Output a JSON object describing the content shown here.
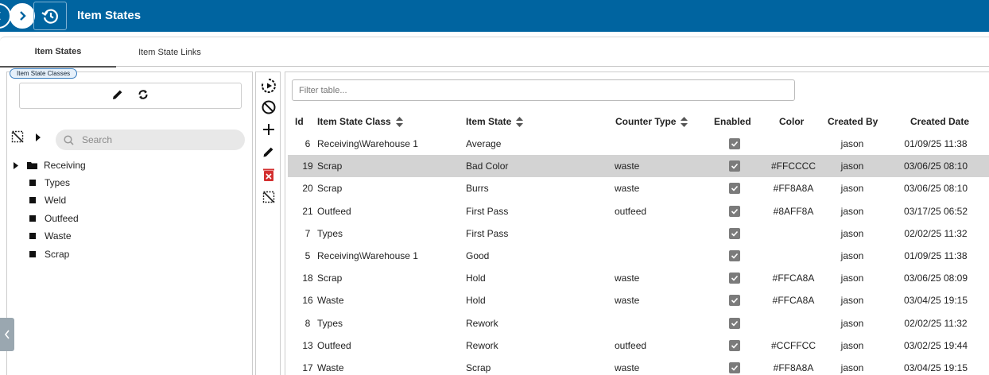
{
  "header": {
    "title": "Item States"
  },
  "tabs": [
    {
      "label": "Item States",
      "active": true
    },
    {
      "label": "Item State Links",
      "active": false
    }
  ],
  "left": {
    "badge": "Item State Classes",
    "search_placeholder": "Search",
    "tree": [
      {
        "label": "Receiving",
        "type": "folder"
      },
      {
        "label": "Types",
        "type": "leaf"
      },
      {
        "label": "Weld",
        "type": "leaf"
      },
      {
        "label": "Outfeed",
        "type": "leaf"
      },
      {
        "label": "Waste",
        "type": "leaf"
      },
      {
        "label": "Scrap",
        "type": "leaf"
      }
    ]
  },
  "toolbar": {
    "icons": [
      "play-circle-icon",
      "block-icon",
      "add-icon",
      "edit-icon",
      "delete-icon",
      "deselect-icon"
    ]
  },
  "table": {
    "filter_placeholder": "Filter table...",
    "columns": [
      "Id",
      "Item State Class",
      "Item State",
      "Counter Type",
      "Enabled",
      "Color",
      "Created By",
      "Created Date"
    ],
    "rows": [
      {
        "id": "6",
        "cls": "Receiving\\Warehouse 1",
        "state": "Average",
        "counter": "",
        "color": "",
        "by": "jason",
        "date": "01/09/25 11:38",
        "enabled": true
      },
      {
        "id": "19",
        "cls": "Scrap",
        "state": "Bad Color",
        "counter": "waste",
        "color": "#FFCCCC",
        "by": "jason",
        "date": "03/06/25 08:10",
        "enabled": true,
        "selected": true
      },
      {
        "id": "20",
        "cls": "Scrap",
        "state": "Burrs",
        "counter": "waste",
        "color": "#FF8A8A",
        "by": "jason",
        "date": "03/06/25 08:10",
        "enabled": true
      },
      {
        "id": "21",
        "cls": "Outfeed",
        "state": "First Pass",
        "counter": "outfeed",
        "color": "#8AFF8A",
        "by": "jason",
        "date": "03/17/25 06:52",
        "enabled": true
      },
      {
        "id": "7",
        "cls": "Types",
        "state": "First Pass",
        "counter": "",
        "color": "",
        "by": "jason",
        "date": "02/02/25 11:32",
        "enabled": true
      },
      {
        "id": "5",
        "cls": "Receiving\\Warehouse 1",
        "state": "Good",
        "counter": "",
        "color": "",
        "by": "jason",
        "date": "01/09/25 11:38",
        "enabled": true
      },
      {
        "id": "18",
        "cls": "Scrap",
        "state": "Hold",
        "counter": "waste",
        "color": "#FFCA8A",
        "by": "jason",
        "date": "03/06/25 08:09",
        "enabled": true
      },
      {
        "id": "16",
        "cls": "Waste",
        "state": "Hold",
        "counter": "waste",
        "color": "#FFCA8A",
        "by": "jason",
        "date": "03/04/25 19:15",
        "enabled": true
      },
      {
        "id": "8",
        "cls": "Types",
        "state": "Rework",
        "counter": "",
        "color": "",
        "by": "jason",
        "date": "02/02/25 11:32",
        "enabled": true
      },
      {
        "id": "13",
        "cls": "Outfeed",
        "state": "Rework",
        "counter": "outfeed",
        "color": "#CCFFCC",
        "by": "jason",
        "date": "03/02/25 19:44",
        "enabled": true
      },
      {
        "id": "17",
        "cls": "Waste",
        "state": "Scrap",
        "counter": "waste",
        "color": "#FF8A8A",
        "by": "jason",
        "date": "03/04/25 19:15",
        "enabled": true
      }
    ]
  }
}
